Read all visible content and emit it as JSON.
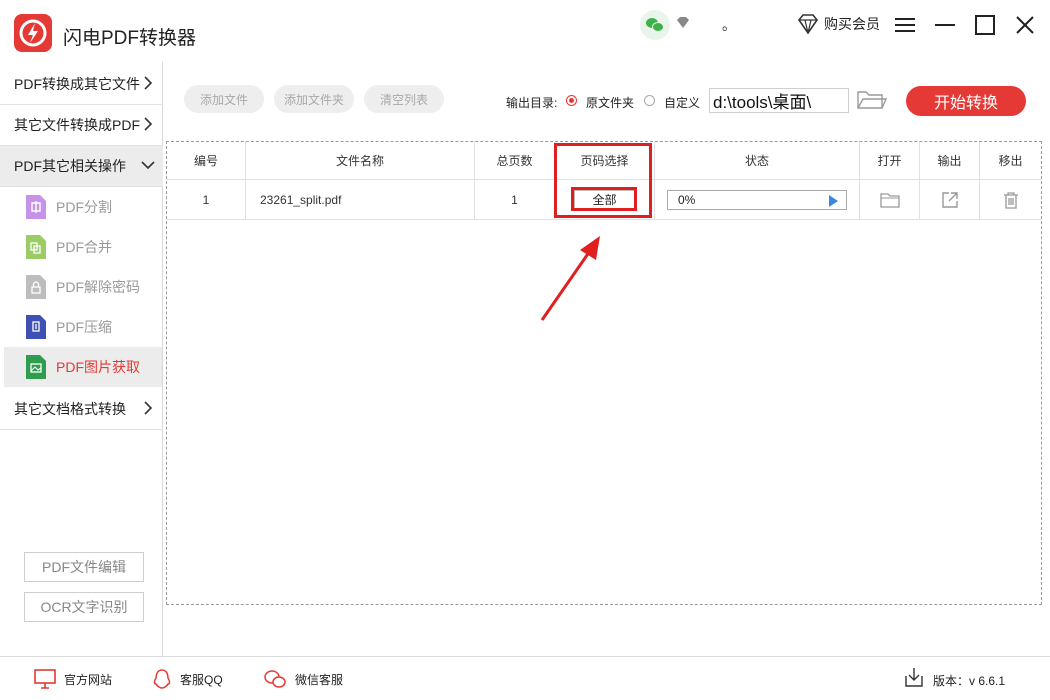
{
  "app": {
    "title": "闪电PDF转换器"
  },
  "header": {
    "dot": "。",
    "buy_label": "购买会员"
  },
  "sidebar": {
    "nav": [
      {
        "label": "PDF转换成其它文件"
      },
      {
        "label": "其它文件转换成PDF"
      },
      {
        "label": "PDF其它相关操作"
      },
      {
        "label": "其它文档格式转换"
      }
    ],
    "sub": [
      {
        "label": "PDF分割",
        "icon": "pdf-split-icon",
        "color": "#c792ea"
      },
      {
        "label": "PDF合并",
        "icon": "pdf-merge-icon",
        "color": "#9ccc65"
      },
      {
        "label": "PDF解除密码",
        "icon": "pdf-unlock-icon",
        "color": "#bdbdbd"
      },
      {
        "label": "PDF压缩",
        "icon": "pdf-compress-icon",
        "color": "#3f51b5"
      },
      {
        "label": "PDF图片获取",
        "icon": "pdf-image-icon",
        "color": "#2e9e4e"
      }
    ],
    "buttons": {
      "edit": "PDF文件编辑",
      "ocr": "OCR文字识别"
    }
  },
  "toolbar": {
    "add_file": "添加文件",
    "add_folder": "添加文件夹",
    "clear_list": "清空列表",
    "output_label": "输出目录:",
    "radio_source": "原文件夹",
    "radio_custom": "自定义",
    "path_value": "d:\\tools\\桌面\\",
    "start": "开始转换"
  },
  "table": {
    "headers": [
      "编号",
      "文件名称",
      "总页数",
      "页码选择",
      "状态",
      "打开",
      "输出",
      "移出"
    ],
    "rows": [
      {
        "index": "1",
        "filename": "23261_split.pdf",
        "pages": "1",
        "page_select": "全部",
        "progress": "0%"
      }
    ]
  },
  "footer": {
    "website": "官方网站",
    "qq": "客服QQ",
    "wechat": "微信客服",
    "version": "版本：v 6.6.1"
  },
  "colors": {
    "accent": "#e53935",
    "highlight": "#e02020"
  }
}
